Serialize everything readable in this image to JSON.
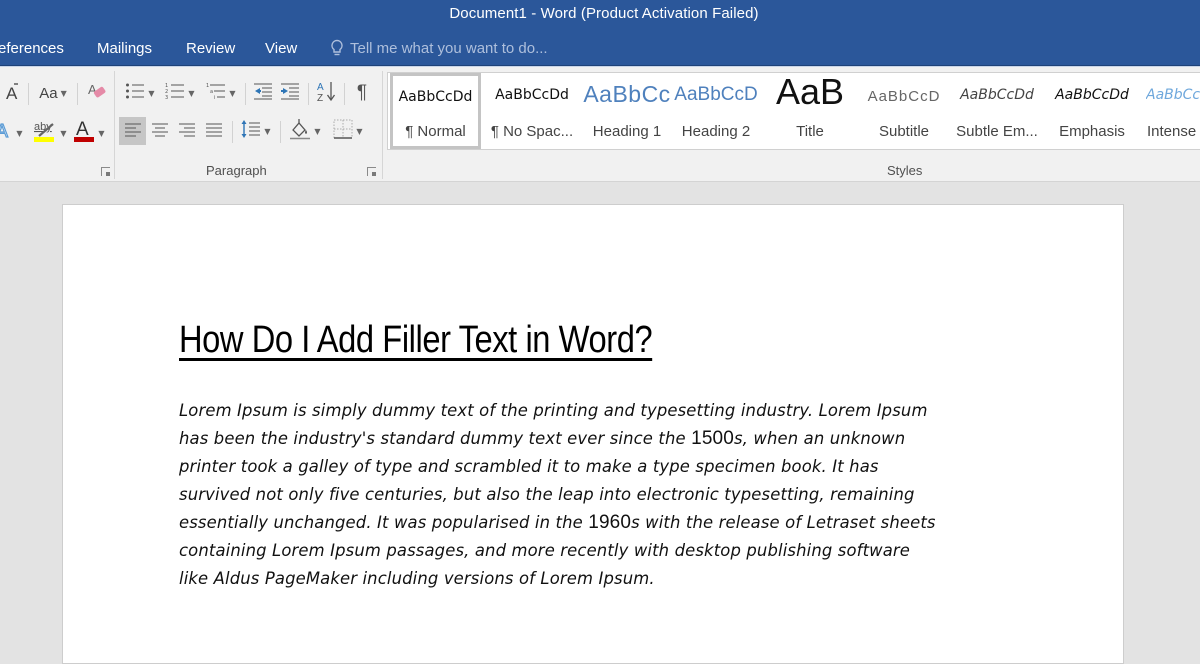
{
  "window": {
    "title": "Document1 - Word (Product Activation Failed)",
    "title_bar_color": "#2b579a"
  },
  "tabs": [
    {
      "label": "eferences",
      "full_label": "References"
    },
    {
      "label": "Mailings"
    },
    {
      "label": "Review"
    },
    {
      "label": "View"
    }
  ],
  "tell_me": {
    "placeholder": "Tell me what you want to do...",
    "icon": "lightbulb-icon"
  },
  "ribbon": {
    "font_group": {
      "buttons": [
        {
          "name": "shrink-font",
          "icon": "font-size-decrease-icon"
        },
        {
          "name": "change-case",
          "label": "Aa",
          "has_dropdown": true
        },
        {
          "name": "clear-formatting",
          "icon": "eraser-icon"
        },
        {
          "name": "text-effects",
          "icon": "text-effects-icon",
          "has_dropdown": true
        },
        {
          "name": "highlight",
          "label": "aby",
          "icon": "highlighter-icon",
          "color": "#ffff00",
          "has_dropdown": true
        },
        {
          "name": "font-color",
          "label": "A",
          "color": "#c00000",
          "has_dropdown": true
        }
      ]
    },
    "paragraph_group": {
      "label": "Paragraph",
      "buttons_row1": [
        {
          "name": "bullets",
          "icon": "bullet-list-icon",
          "has_dropdown": true
        },
        {
          "name": "numbering",
          "icon": "numbered-list-icon",
          "has_dropdown": true
        },
        {
          "name": "multilevel-list",
          "icon": "multilevel-list-icon",
          "has_dropdown": true
        },
        {
          "name": "decrease-indent",
          "icon": "decrease-indent-icon"
        },
        {
          "name": "increase-indent",
          "icon": "increase-indent-icon"
        },
        {
          "name": "sort",
          "icon": "sort-az-icon"
        },
        {
          "name": "show-hide",
          "label": "¶",
          "icon": "pilcrow-icon"
        }
      ],
      "buttons_row2": [
        {
          "name": "align-left",
          "icon": "align-left-icon",
          "active": true
        },
        {
          "name": "center",
          "icon": "align-center-icon"
        },
        {
          "name": "align-right",
          "icon": "align-right-icon"
        },
        {
          "name": "justify",
          "icon": "justify-icon"
        },
        {
          "name": "line-spacing",
          "icon": "line-spacing-icon",
          "has_dropdown": true
        },
        {
          "name": "shading",
          "icon": "paint-bucket-icon",
          "has_dropdown": true
        },
        {
          "name": "borders",
          "icon": "borders-icon",
          "has_dropdown": true
        }
      ]
    },
    "styles_group": {
      "label": "Styles",
      "items": [
        {
          "sample": "AaBbCcDd",
          "name": "¶ Normal",
          "selected": true
        },
        {
          "sample": "AaBbCcDd",
          "name": "¶ No Spac..."
        },
        {
          "sample": "AaBbCc",
          "name": "Heading 1"
        },
        {
          "sample": "AaBbCcD",
          "name": "Heading 2"
        },
        {
          "sample": "AaB",
          "name": "Title"
        },
        {
          "sample": "AaBbCcD",
          "name": "Subtitle"
        },
        {
          "sample": "AaBbCcDd",
          "name": "Subtle Em..."
        },
        {
          "sample": "AaBbCcDd",
          "name": "Emphasis"
        },
        {
          "sample": "AaBbCc",
          "name": "Intense"
        }
      ]
    }
  },
  "document": {
    "heading": "How Do I Add Filler Text in Word?",
    "body_lines": [
      [
        "Lorem Ipsum is simply dummy text of the printing and typesetting industry. Lorem Ipsum"
      ],
      [
        "has been the industry's standard dummy text ever since the ",
        "1500",
        "s, when an unknown"
      ],
      [
        "printer took a galley of type and scrambled it to make a type specimen book. It has"
      ],
      [
        "survived not only five centuries, but also the leap into electronic typesetting, remaining"
      ],
      [
        "essentially unchanged. It was popularised in the ",
        "1960",
        "s with the release of Letraset sheets"
      ],
      [
        "containing Lorem Ipsum passages, and more recently with desktop publishing software"
      ],
      [
        "like Aldus PageMaker including versions of Lorem Ipsum."
      ]
    ]
  }
}
